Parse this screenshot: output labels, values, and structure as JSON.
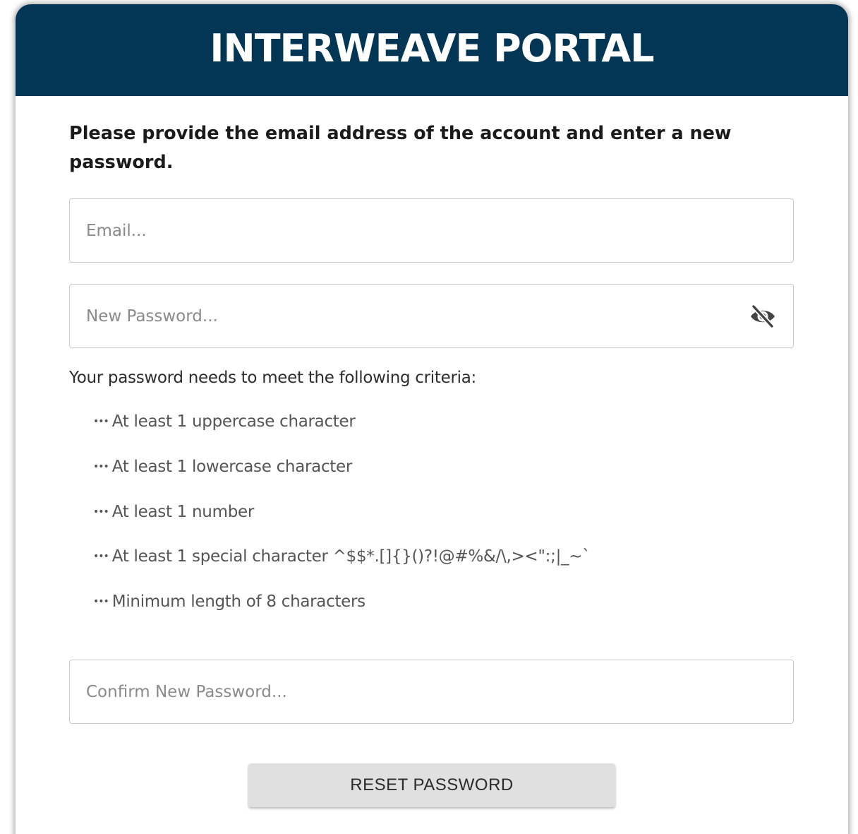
{
  "header": {
    "title": "INTERWEAVE PORTAL"
  },
  "form": {
    "instructions": "Please provide the email address of the account and enter a new password.",
    "email": {
      "value": "",
      "placeholder": "Email..."
    },
    "new_password": {
      "value": "",
      "placeholder": "New Password...",
      "toggle_icon": "eye-off-icon"
    },
    "criteria_heading": "Your password needs to meet the following criteria:",
    "criteria_bullet": "•••",
    "criteria": [
      "At least 1 uppercase character",
      "At least 1 lowercase character",
      "At least 1 number",
      "At least 1 special character ^$$*.[]{}()?!@#%&/\\,><\":;|_~`",
      "Minimum length of 8 characters"
    ],
    "confirm_password": {
      "value": "",
      "placeholder": "Confirm New Password..."
    },
    "submit_label": "RESET PASSWORD"
  },
  "colors": {
    "header_background": "#023654",
    "header_text": "#ffffff",
    "button_background": "#e0e0e0"
  }
}
